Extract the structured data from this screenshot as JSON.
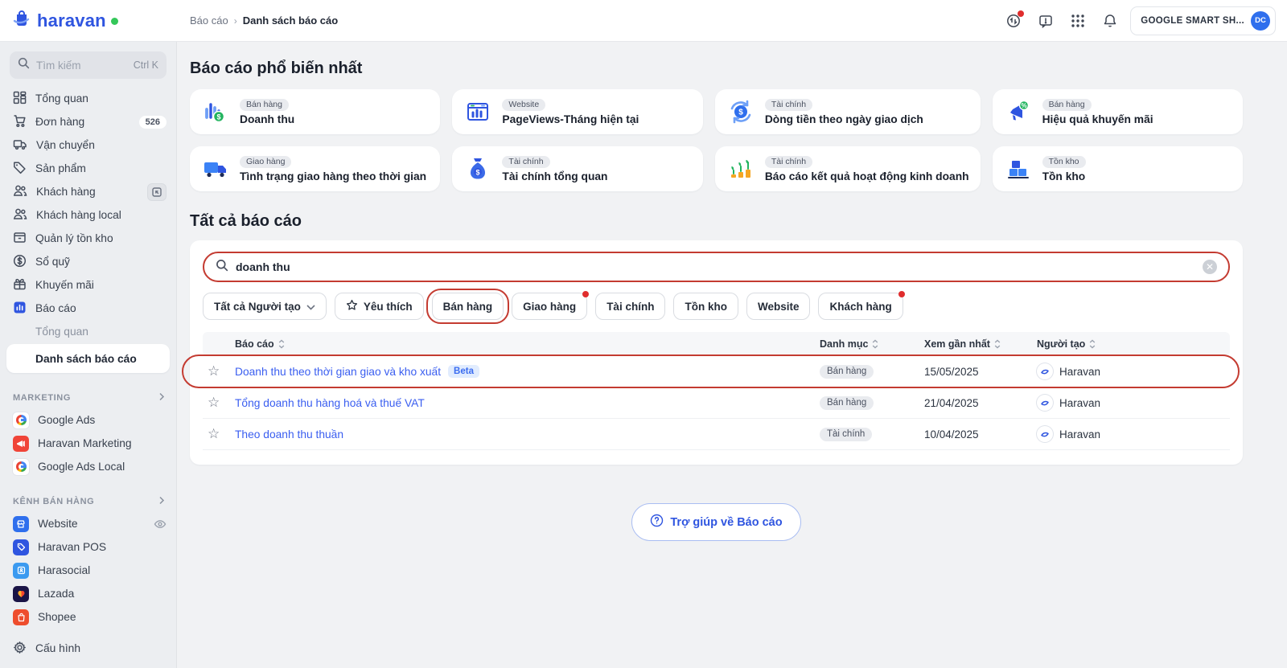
{
  "colors": {
    "accent": "#2F55E0",
    "link": "#3A5EF0",
    "annotation": "#C43B31",
    "success_dot": "#34C759",
    "alert_dot": "#E02D2D"
  },
  "topbar": {
    "logo_text": "haravan",
    "breadcrumb": {
      "parent": "Báo cáo",
      "separator": "›",
      "current": "Danh sách báo cáo"
    },
    "account": {
      "name": "GOOGLE SMART SH...",
      "avatar_initials": "DC"
    }
  },
  "sidebar": {
    "search": {
      "placeholder": "Tìm kiếm",
      "shortcut": "Ctrl K"
    },
    "items": [
      {
        "label": "Tổng quan",
        "icon": "dashboard-icon"
      },
      {
        "label": "Đơn hàng",
        "icon": "cart-icon",
        "badge": "526"
      },
      {
        "label": "Vận chuyển",
        "icon": "truck-icon"
      },
      {
        "label": "Sản phẩm",
        "icon": "tag-icon"
      },
      {
        "label": "Khách hàng",
        "icon": "users-icon"
      },
      {
        "label": "Khách hàng local",
        "icon": "users-icon"
      },
      {
        "label": "Quản lý tồn kho",
        "icon": "inventory-icon"
      },
      {
        "label": "Sổ quỹ",
        "icon": "cash-icon"
      },
      {
        "label": "Khuyến mãi",
        "icon": "promo-icon"
      },
      {
        "label": "Báo cáo",
        "icon": "report-icon",
        "active": true
      }
    ],
    "report_sub": [
      {
        "label": "Tổng quan",
        "active": false
      },
      {
        "label": "Danh sách báo cáo",
        "active": true
      }
    ],
    "marketing": {
      "title": "MARKETING",
      "items": [
        {
          "label": "Google Ads"
        },
        {
          "label": "Haravan Marketing"
        },
        {
          "label": "Google Ads Local"
        }
      ]
    },
    "channels": {
      "title": "KÊNH BÁN HÀNG",
      "items": [
        {
          "label": "Website",
          "eye": true
        },
        {
          "label": "Haravan POS"
        },
        {
          "label": "Harasocial"
        },
        {
          "label": "Lazada"
        },
        {
          "label": "Shopee"
        }
      ]
    },
    "config_label": "Cấu hình"
  },
  "main": {
    "popular": {
      "title": "Báo cáo phổ biến nhất",
      "cards": [
        {
          "tag": "Bán hàng",
          "title": "Doanh thu",
          "icon": "revenue-bars-icon"
        },
        {
          "tag": "Website",
          "title": "PageViews-Tháng hiện tại",
          "icon": "pageviews-icon"
        },
        {
          "tag": "Tài chính",
          "title": "Dòng tiền theo ngày giao dịch",
          "icon": "cashflow-icon"
        },
        {
          "tag": "Bán hàng",
          "title": "Hiệu quả khuyến mãi",
          "icon": "promotion-icon"
        },
        {
          "tag": "Giao hàng",
          "title": "Tình trạng giao hàng theo thời gian",
          "icon": "delivery-truck-icon"
        },
        {
          "tag": "Tài chính",
          "title": "Tài chính tổng quan",
          "icon": "money-bag-icon"
        },
        {
          "tag": "Tài chính",
          "title": "Báo cáo kết quả hoạt động kinh doanh",
          "icon": "growth-icon"
        },
        {
          "tag": "Tồn kho",
          "title": "Tồn kho",
          "icon": "inventory-boxes-icon"
        }
      ]
    },
    "all_reports": {
      "title": "Tất cả báo cáo",
      "search_value": "doanh thu",
      "filters": {
        "creator_dropdown": "Tất cả Người tạo",
        "favorite": "Yêu thích",
        "chips": [
          {
            "label": "Bán hàng",
            "annotated": true
          },
          {
            "label": "Giao hàng",
            "dot": true
          },
          {
            "label": "Tài chính"
          },
          {
            "label": "Tồn kho"
          },
          {
            "label": "Website"
          },
          {
            "label": "Khách hàng",
            "dot": true
          }
        ]
      },
      "table": {
        "columns": [
          "Báo cáo",
          "Danh mục",
          "Xem gần nhất",
          "Người tạo"
        ],
        "rows": [
          {
            "name": "Doanh thu theo thời gian giao và kho xuất",
            "beta": "Beta",
            "category": "Bán hàng",
            "last_viewed": "15/05/2025",
            "creator": "Haravan",
            "annotated": true
          },
          {
            "name": "Tổng doanh thu hàng hoá và thuế VAT",
            "category": "Bán hàng",
            "last_viewed": "21/04/2025",
            "creator": "Haravan"
          },
          {
            "name": "Theo doanh thu thuần",
            "category": "Tài chính",
            "last_viewed": "10/04/2025",
            "creator": "Haravan"
          }
        ]
      }
    },
    "help_label": "Trợ giúp về Báo cáo"
  }
}
